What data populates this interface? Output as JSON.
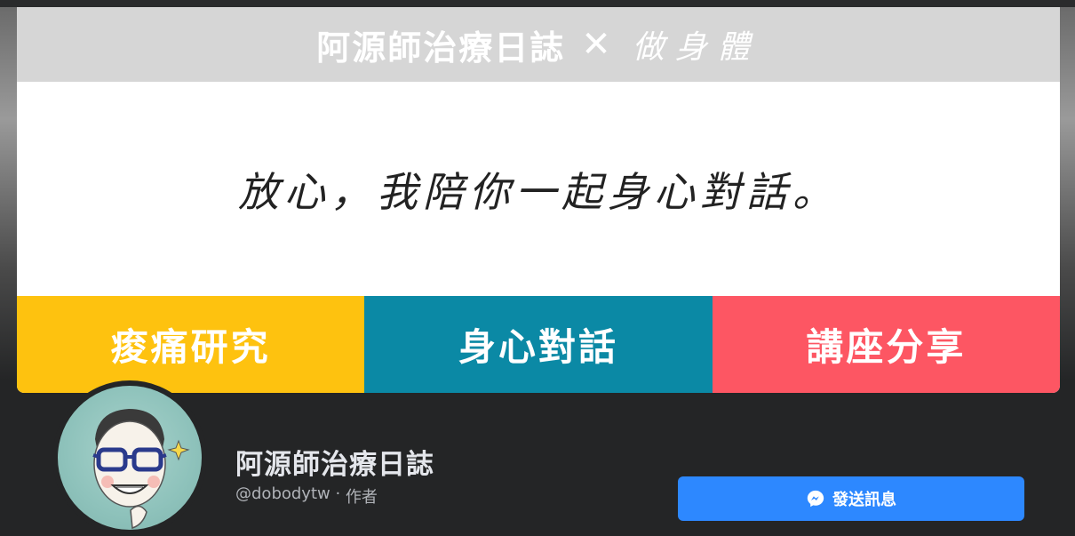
{
  "cover": {
    "header_title": "阿源師治療日誌",
    "header_x": "✕",
    "header_script": "做身體",
    "slogan": "放心，我陪你一起身心對話。",
    "categories": [
      {
        "label": "痠痛研究",
        "color": "#fec20f"
      },
      {
        "label": "身心對話",
        "color": "#0b89a5"
      },
      {
        "label": "講座分享",
        "color": "#fd5663"
      }
    ]
  },
  "profile": {
    "name": "阿源師治療日誌",
    "handle": "@dobodytw",
    "separator": " · ",
    "role": "作者",
    "avatar_icon": "cartoon-avatar-glasses"
  },
  "actions": {
    "message_label": "發送訊息",
    "message_icon": "messenger-icon"
  },
  "colors": {
    "page_bg": "#242526",
    "button_blue": "#2d88ff",
    "text_primary": "#e4e6eb",
    "text_secondary": "#b0b3b8"
  }
}
